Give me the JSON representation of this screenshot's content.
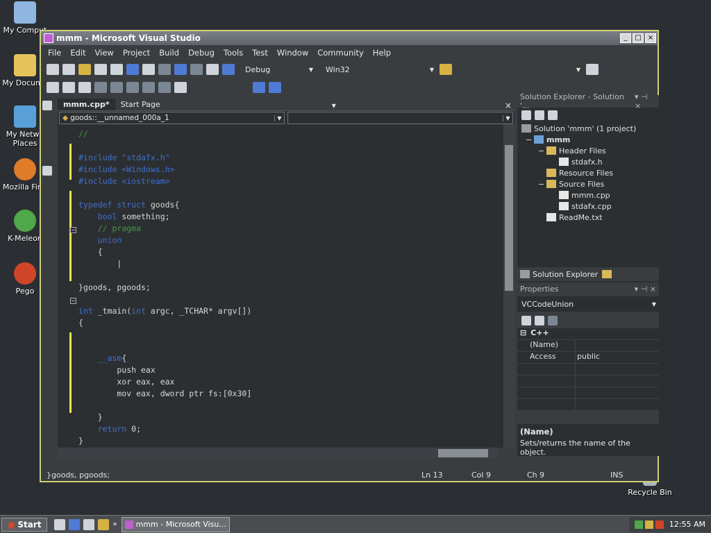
{
  "desktop": {
    "icons": [
      {
        "label": "My Comput"
      },
      {
        "label": "My Docume"
      },
      {
        "label": "My Netwo\nPlaces"
      },
      {
        "label": "Mozilla Firel"
      },
      {
        "label": "K-Meleon"
      },
      {
        "label": "Pego"
      },
      {
        "label": "Recycle Bin"
      }
    ]
  },
  "window": {
    "title": "mmm - Microsoft Visual Studio",
    "controls": [
      "_",
      "□",
      "×"
    ]
  },
  "menu": [
    "File",
    "Edit",
    "View",
    "Project",
    "Build",
    "Debug",
    "Tools",
    "Test",
    "Window",
    "Community",
    "Help"
  ],
  "toolbar": {
    "config": "Debug",
    "platform": "Win32"
  },
  "editor": {
    "tabs": [
      "mmm.cpp*",
      "Start Page"
    ],
    "nav_left": "goods::__unnamed_000a_1",
    "nav_right": "",
    "code": [
      [
        {
          "t": "//",
          "c": "com"
        }
      ],
      [],
      [
        {
          "t": "#include \"stdafx.h\"",
          "c": "kw"
        }
      ],
      [
        {
          "t": "#include <Windows.h>",
          "c": "kw"
        }
      ],
      [
        {
          "t": "#include <iostream>",
          "c": "kw"
        }
      ],
      [],
      [
        {
          "t": "typedef struct",
          "c": "kw"
        },
        {
          "t": " goods{"
        }
      ],
      [
        {
          "t": "    "
        },
        {
          "t": "bool",
          "c": "kw"
        },
        {
          "t": " something;"
        }
      ],
      [
        {
          "t": "    "
        },
        {
          "t": "// pragma",
          "c": "com"
        }
      ],
      [
        {
          "t": "    "
        },
        {
          "t": "union",
          "c": "kw"
        }
      ],
      [
        {
          "t": "    {"
        }
      ],
      [
        {
          "t": "        |"
        }
      ],
      [],
      [
        {
          "t": "}goods, pgoods;"
        }
      ],
      [],
      [
        {
          "t": "int",
          "c": "kw"
        },
        {
          "t": " _tmain("
        },
        {
          "t": "int",
          "c": "kw"
        },
        {
          "t": " argc, _TCHAR* argv[])"
        }
      ],
      [
        {
          "t": "{"
        }
      ],
      [],
      [],
      [
        {
          "t": "    "
        },
        {
          "t": "__asm",
          "c": "kw"
        },
        {
          "t": "{"
        }
      ],
      [
        {
          "t": "        push eax"
        }
      ],
      [
        {
          "t": "        xor eax, eax"
        }
      ],
      [
        {
          "t": "        mov eax, dword ptr fs:[0x30]"
        }
      ],
      [],
      [
        {
          "t": "    }"
        }
      ],
      [
        {
          "t": "    "
        },
        {
          "t": "return",
          "c": "kw"
        },
        {
          "t": " 0;"
        }
      ],
      [
        {
          "t": "}"
        }
      ]
    ]
  },
  "solution_explorer": {
    "header": "Solution Explorer - Solution '...",
    "items": [
      {
        "label": "Solution 'mmm' (1 project)",
        "type": "sln",
        "indent": 0,
        "toggle": ""
      },
      {
        "label": "mmm",
        "type": "proj",
        "indent": 1,
        "toggle": "−",
        "bold": true
      },
      {
        "label": "Header Files",
        "type": "folder",
        "indent": 2,
        "toggle": "−"
      },
      {
        "label": "stdafx.h",
        "type": "file",
        "indent": 3,
        "toggle": ""
      },
      {
        "label": "Resource Files",
        "type": "folder",
        "indent": 2,
        "toggle": ""
      },
      {
        "label": "Source Files",
        "type": "folder",
        "indent": 2,
        "toggle": "−"
      },
      {
        "label": "mmm.cpp",
        "type": "file",
        "indent": 3,
        "toggle": ""
      },
      {
        "label": "stdafx.cpp",
        "type": "file",
        "indent": 3,
        "toggle": ""
      },
      {
        "label": "ReadMe.txt",
        "type": "file",
        "indent": 2,
        "toggle": ""
      }
    ],
    "footer": "Solution Explorer"
  },
  "properties": {
    "header": "Properties",
    "object": "VCCodeUnion",
    "category": "C++",
    "rows": [
      {
        "key": "(Name)",
        "value": ""
      },
      {
        "key": "Access",
        "value": "public"
      }
    ],
    "desc_title": "(Name)",
    "desc_text": "Sets/returns the name of the object."
  },
  "status": {
    "text": "}goods, pgoods;",
    "line": "Ln 13",
    "col": "Col 9",
    "ch": "Ch 9",
    "mode": "INS"
  },
  "taskbar": {
    "start": "Start",
    "task": "mmm - Microsoft Visu...",
    "time": "12:55 AM"
  },
  "colors": {
    "accent_border": "#cfcf7a",
    "keyword": "#3d6fd0",
    "string": "#c73a3a",
    "comment": "#3d9b3d",
    "change_bar": "#e6e64c"
  }
}
